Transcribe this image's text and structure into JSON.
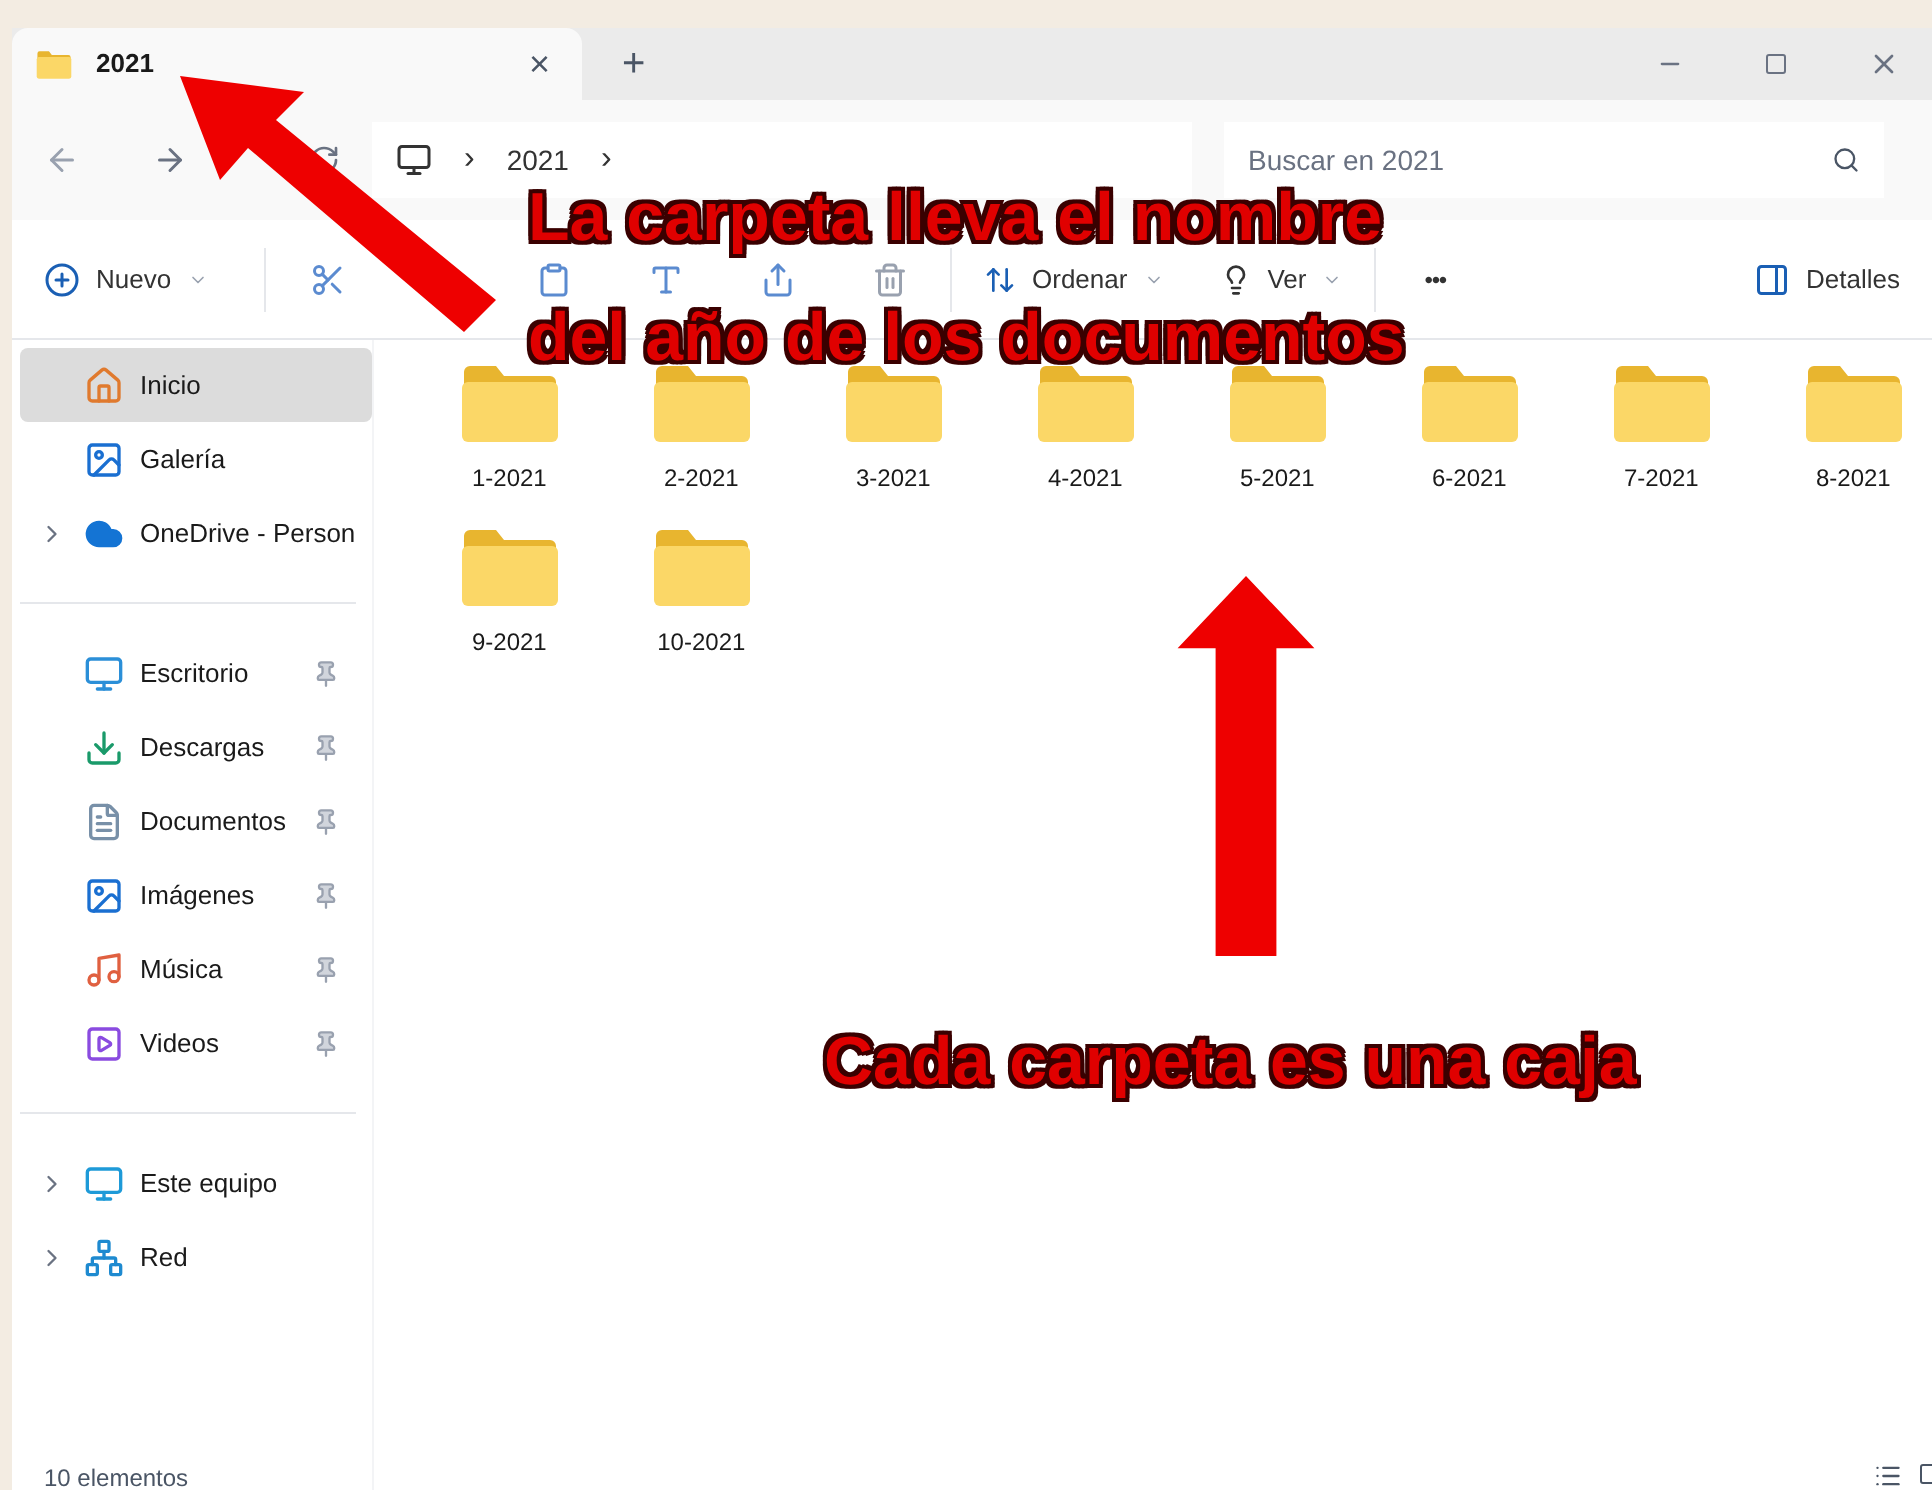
{
  "tab": {
    "title": "2021",
    "close": "×",
    "new": "+"
  },
  "breadcrumb": {
    "path": "2021",
    "sep": "›"
  },
  "search": {
    "placeholder": "Buscar en 2021"
  },
  "toolbar": {
    "new": "Nuevo",
    "sort": "Ordenar",
    "view": "Ver",
    "more": "•••",
    "details": "Detalles"
  },
  "sidebar": [
    [
      {
        "label": "Inicio",
        "kind": "home",
        "selected": true,
        "expandable": false,
        "pinned": false
      },
      {
        "label": "Galería",
        "kind": "gallery",
        "selected": false,
        "expandable": false,
        "pinned": false
      },
      {
        "label": "OneDrive - Person",
        "kind": "cloud",
        "selected": false,
        "expandable": true,
        "pinned": false
      }
    ],
    [
      {
        "label": "Escritorio",
        "kind": "desktop",
        "selected": false,
        "expandable": false,
        "pinned": true
      },
      {
        "label": "Descargas",
        "kind": "download",
        "selected": false,
        "expandable": false,
        "pinned": true
      },
      {
        "label": "Documentos",
        "kind": "docs",
        "selected": false,
        "expandable": false,
        "pinned": true
      },
      {
        "label": "Imágenes",
        "kind": "gallery",
        "selected": false,
        "expandable": false,
        "pinned": true
      },
      {
        "label": "Música",
        "kind": "music",
        "selected": false,
        "expandable": false,
        "pinned": true
      },
      {
        "label": "Videos",
        "kind": "video",
        "selected": false,
        "expandable": false,
        "pinned": true
      }
    ],
    [
      {
        "label": "Este equipo",
        "kind": "pc",
        "selected": false,
        "expandable": true,
        "pinned": false
      },
      {
        "label": "Red",
        "kind": "network",
        "selected": false,
        "expandable": true,
        "pinned": false
      }
    ]
  ],
  "folders": [
    "1-2021",
    "2-2021",
    "3-2021",
    "4-2021",
    "5-2021",
    "6-2021",
    "7-2021",
    "8-2021",
    "9-2021",
    "10-2021"
  ],
  "status_bar": "10 elementos",
  "annotations": [
    {
      "lines": [
        "La carpeta lleva el nombre",
        "del año de los documentos"
      ]
    },
    {
      "lines": [
        "Cada carpeta es una caja"
      ]
    }
  ]
}
